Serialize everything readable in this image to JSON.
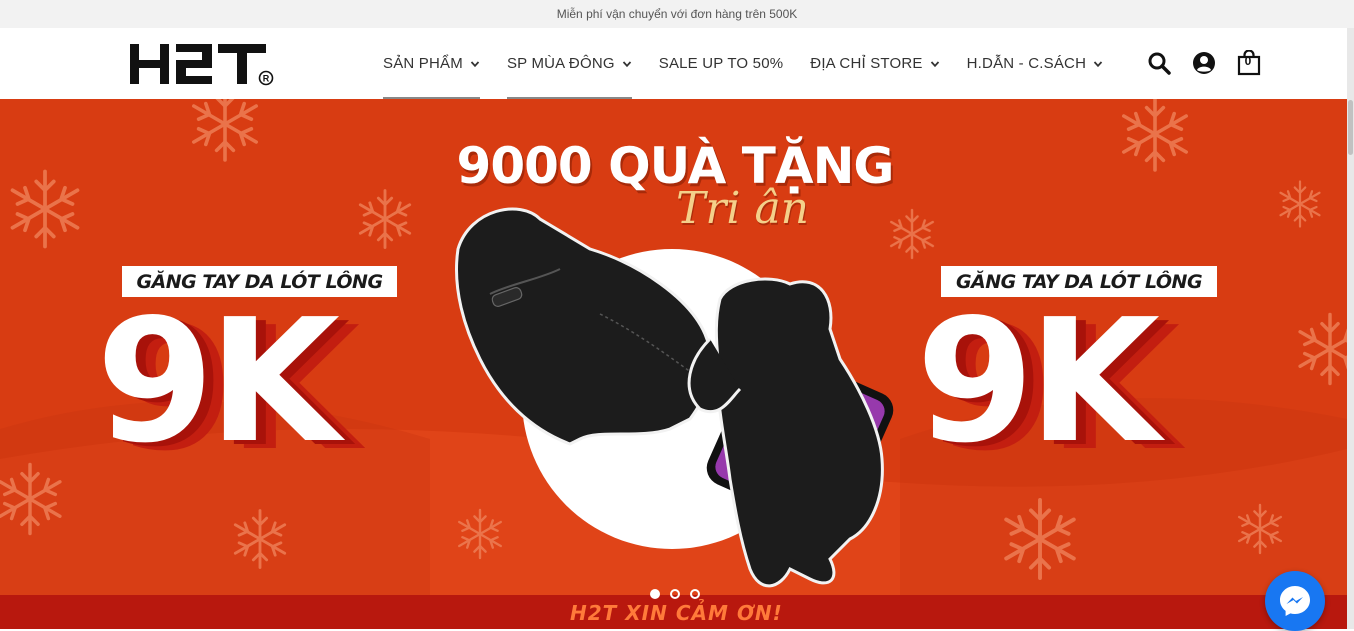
{
  "topbar": {
    "text": "Miễn phí vận chuyển với đơn hàng trên 500K"
  },
  "brand": {
    "logo_alt": "H2T®"
  },
  "nav": {
    "items": [
      {
        "label": "SẢN PHẨM",
        "has_dropdown": true
      },
      {
        "label": "SP MÙA ĐÔNG",
        "has_dropdown": true
      },
      {
        "label": "SALE UP TO 50%",
        "has_dropdown": false
      },
      {
        "label": "ĐỊA CHỈ STORE",
        "has_dropdown": true
      },
      {
        "label": "H.DẪN - C.SÁCH",
        "has_dropdown": true
      }
    ]
  },
  "tools": {
    "search_icon": "search-icon",
    "account_icon": "user-icon",
    "cart_icon": "shopping-bag-icon",
    "cart_count": "0"
  },
  "banner": {
    "headline": "9000 QUÀ TẶNG",
    "subhead": "Tri ân",
    "left_tag": "GĂNG TAY DA LÓT LÔNG",
    "left_price": "9K",
    "right_tag": "GĂNG TAY DA LÓT LÔNG",
    "right_price": "9K",
    "footer_text": "H2T XIN CẢM ƠN!",
    "slides": 3,
    "active_slide": 1
  },
  "colors": {
    "banner_red": "#d83c12",
    "accent_gold": "#f4d08a",
    "messenger_blue": "#1877f2"
  },
  "chat": {
    "icon": "messenger-icon"
  }
}
